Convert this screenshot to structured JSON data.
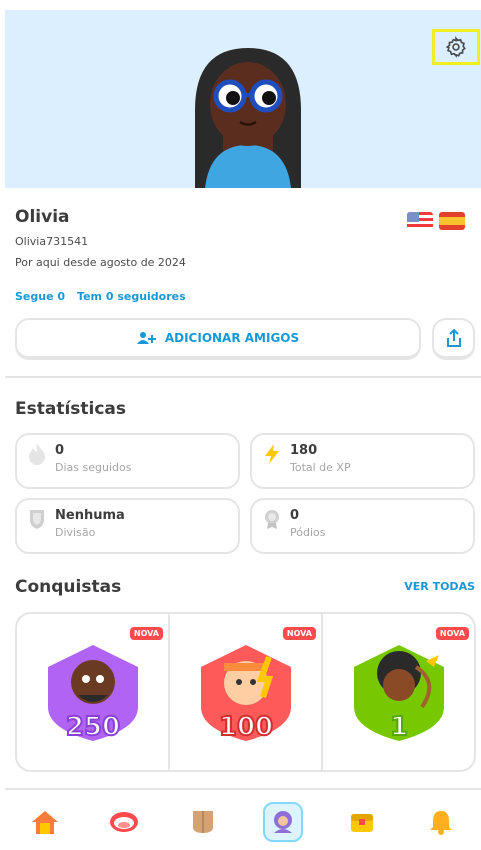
{
  "profile": {
    "name": "Olivia",
    "username": "Olivia731541",
    "since": "Por aqui desde agosto de 2024",
    "following": "Segue 0",
    "followers": "Tem 0 seguidores"
  },
  "actions": {
    "add_friends": "ADICIONAR AMIGOS"
  },
  "stats": {
    "title": "Estatísticas",
    "items": [
      {
        "value": "0",
        "label": "Dias seguidos",
        "icon": "flame-icon"
      },
      {
        "value": "180",
        "label": "Total de XP",
        "icon": "lightning-icon"
      },
      {
        "value": "Nenhuma",
        "label": "Divisão",
        "icon": "shield-icon"
      },
      {
        "value": "0",
        "label": "Pódios",
        "icon": "medal-icon"
      }
    ]
  },
  "achievements": {
    "title": "Conquistas",
    "view_all": "VER TODAS",
    "badge_label": "NOVA",
    "items": [
      {
        "count": "250",
        "color": "#b164f4"
      },
      {
        "count": "100",
        "color": "#ff5a5a"
      },
      {
        "count": "1",
        "color": "#78c800"
      }
    ]
  },
  "nav": [
    "home-icon",
    "speak-icon",
    "letters-icon",
    "profile-icon",
    "chest-icon",
    "bell-icon"
  ]
}
